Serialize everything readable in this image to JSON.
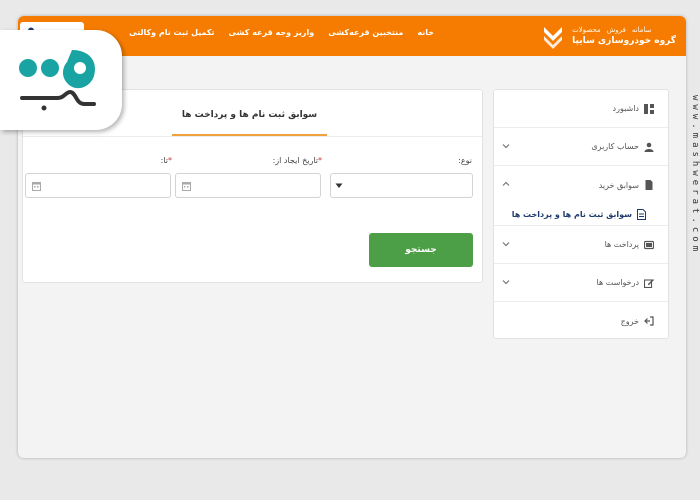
{
  "brand": {
    "links": [
      "سامانه",
      "فروش",
      "محصولات"
    ],
    "name": "گروه خودروسازی سایپا"
  },
  "topnav": {
    "items": [
      "خانه",
      "منتخبین قرعه‌کشی",
      "واریز وجه قرعه کشی",
      "تکمیل ثبت نام وکالتی"
    ]
  },
  "sidebar": {
    "dashboard": "داشبورد",
    "account": "حساب کاربری",
    "purchase_history": "سوابق خرید",
    "sub_registrations": "سوابق ثبت نام ها و پرداخت ها",
    "payments": "پرداخت ها",
    "requests": "درخواست ها",
    "logout": "خروج"
  },
  "main": {
    "title": "سوابق ثبت نام ها و پرداخت ها",
    "type_label": "نوع:",
    "from_label": "تاریخ ایجاد از:",
    "to_label": "تا:",
    "required_mark": "*",
    "search_label": "جستجو"
  },
  "watermark": {
    "vertical_text": "www.mashwerat.com"
  },
  "colors": {
    "accent": "#f57c00",
    "button": "#4d9f47",
    "link": "#1f3b6e"
  }
}
